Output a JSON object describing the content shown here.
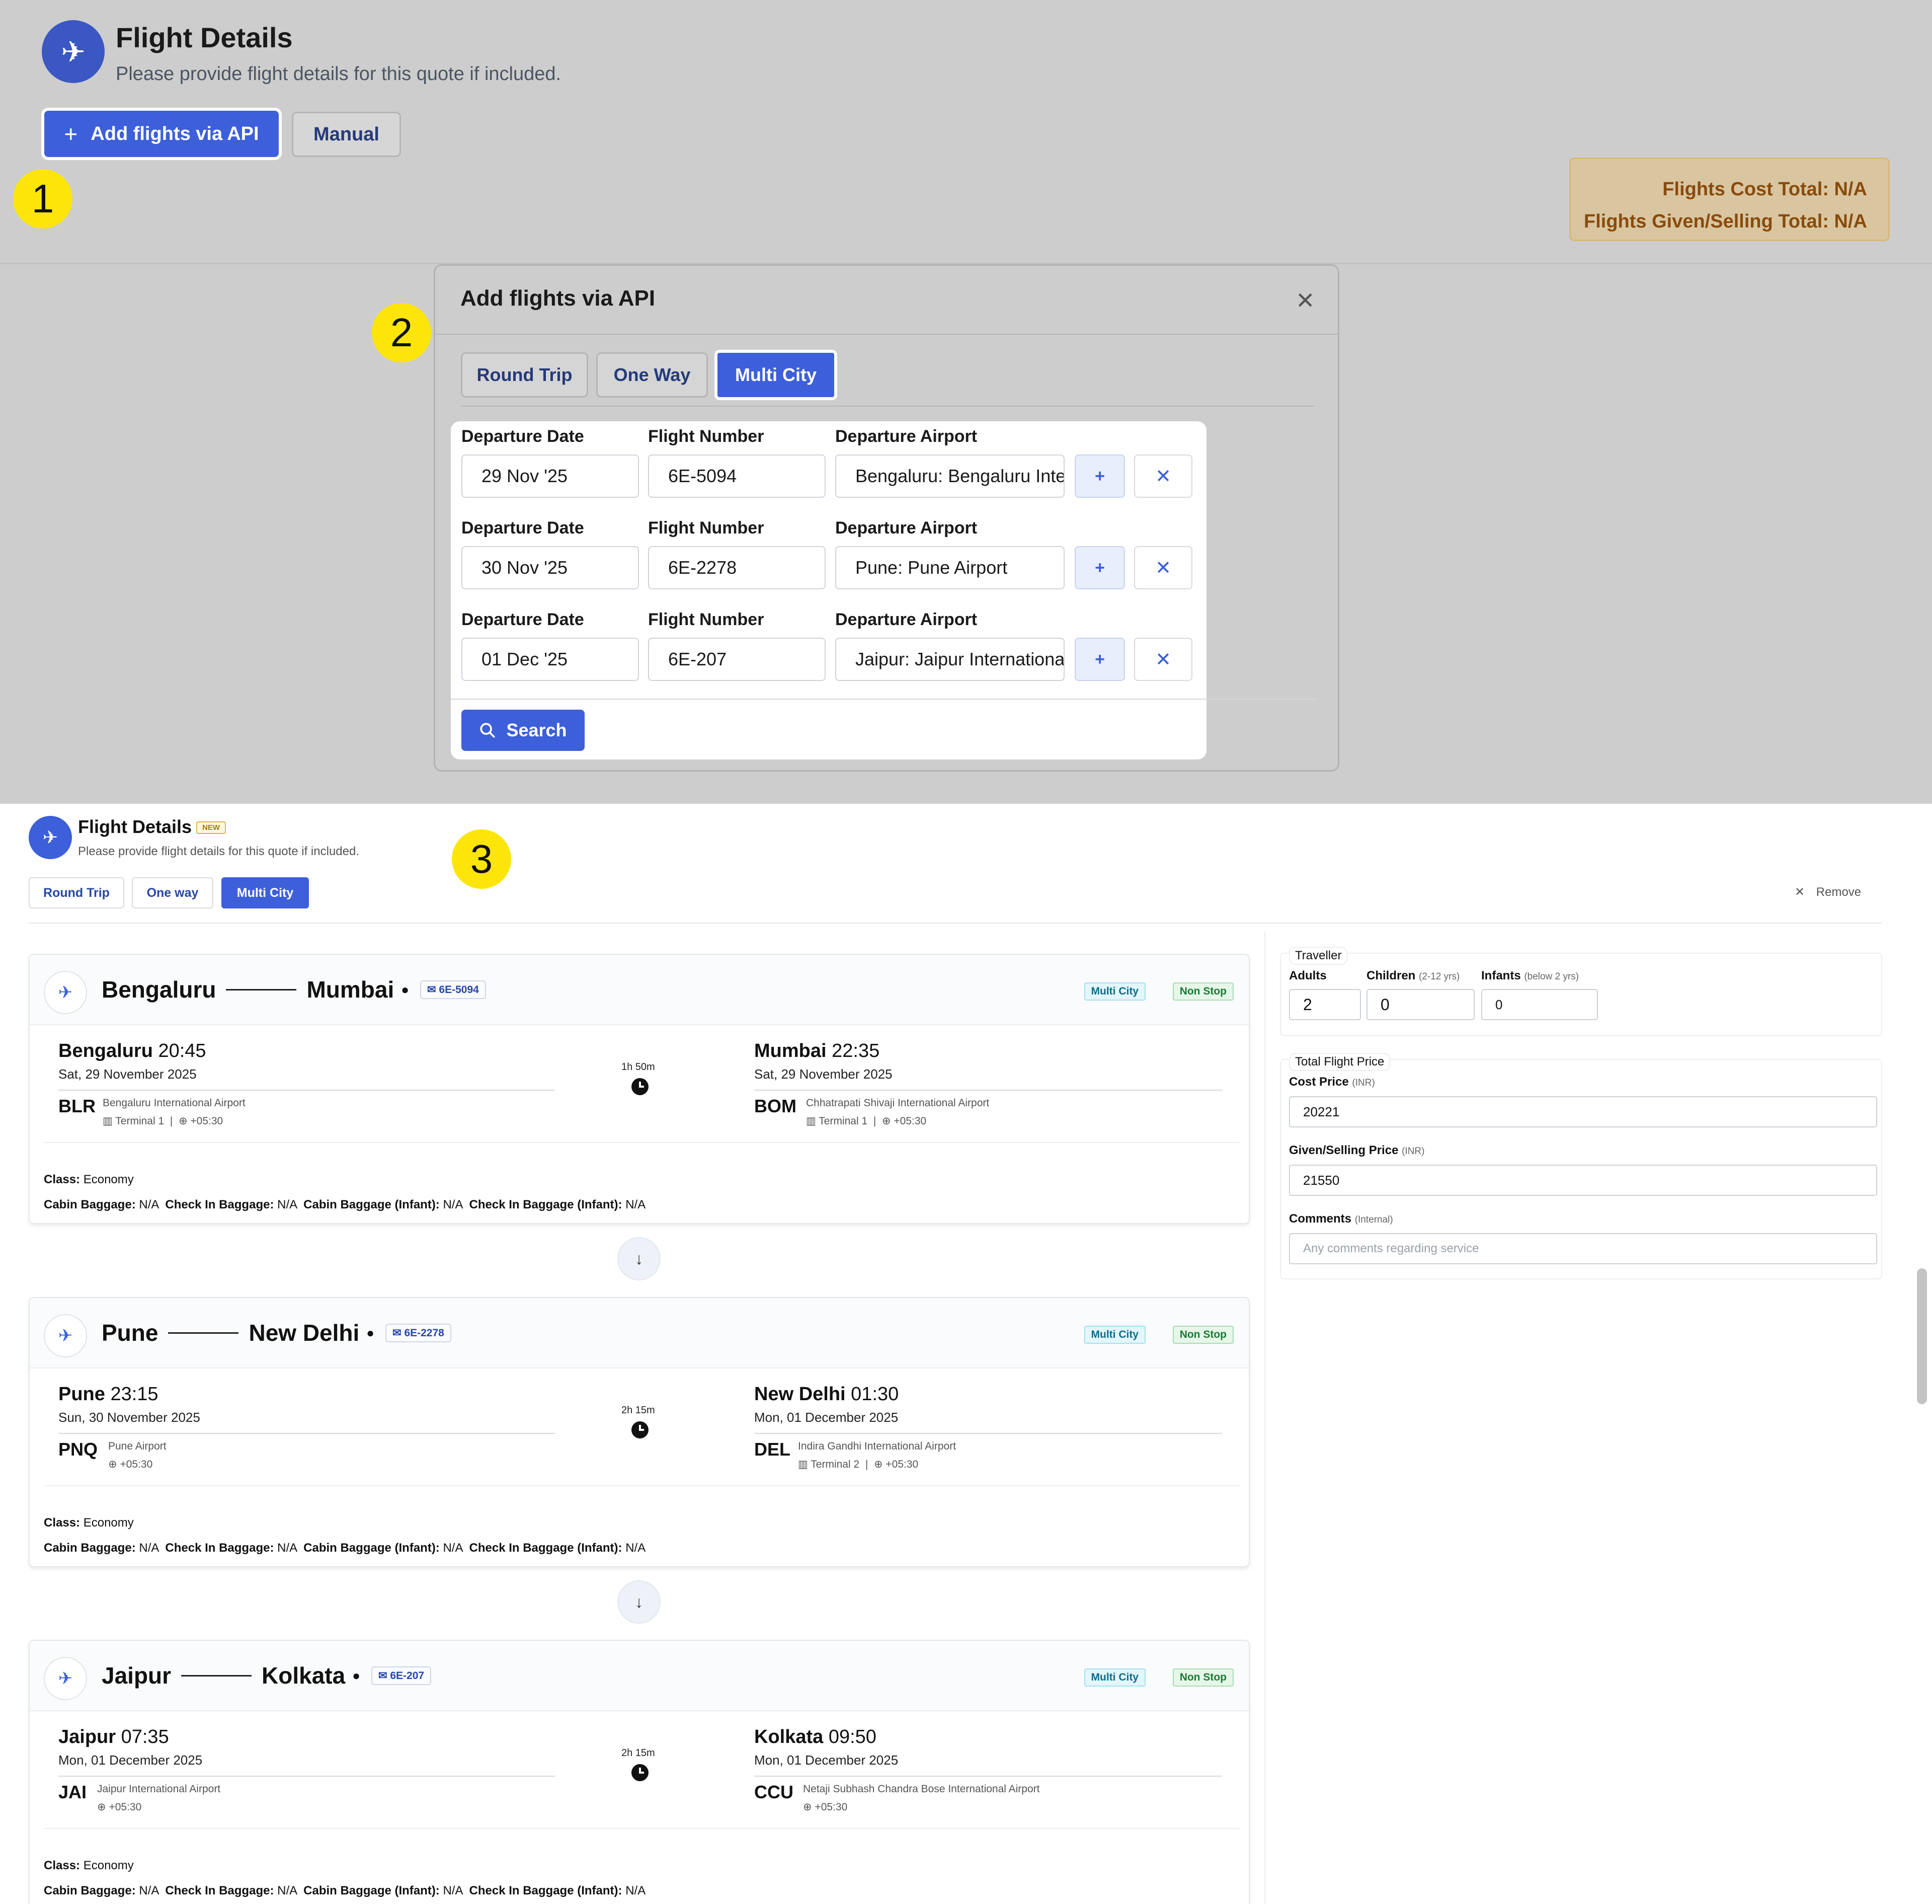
{
  "top": {
    "title": "Flight Details",
    "subtitle": "Please provide flight details for this quote if included.",
    "add_api_label": "Add flights via API",
    "manual_label": "Manual",
    "cost_total": "Flights Cost Total: N/A",
    "selling_total": "Flights Given/Selling Total: N/A"
  },
  "steps": [
    "1",
    "2",
    "3"
  ],
  "modal": {
    "title": "Add flights via API",
    "tabs": [
      "Round Trip",
      "One Way",
      "Multi City"
    ],
    "labels": {
      "date": "Departure Date",
      "flight": "Flight Number",
      "airport": "Departure Airport"
    },
    "rows": [
      {
        "date": "29 Nov '25",
        "flight": "6E-5094",
        "airport": "Bengaluru:  Bengaluru International Airport"
      },
      {
        "date": "30 Nov '25",
        "flight": "6E-2278",
        "airport": "Pune:  Pune Airport"
      },
      {
        "date": "01 Dec '25",
        "flight": "6E-207",
        "airport": "Jaipur:  Jaipur International Airport"
      }
    ],
    "search_label": "Search"
  },
  "panel3": {
    "title": "Flight Details",
    "new_badge": "NEW",
    "subtitle": "Please provide flight details for this quote if included.",
    "tabs": [
      "Round Trip",
      "One way",
      "Multi City"
    ],
    "remove_label": "Remove"
  },
  "flights": [
    {
      "from": "Bengaluru",
      "to": "Mumbai",
      "number": "6E-5094",
      "dep_time": "20:45",
      "dep_date": "Sat, 29 November 2025",
      "dep_code": "BLR",
      "dep_airport": "Bengaluru International Airport",
      "dep_terminal": "Terminal 1",
      "dep_tz": "+05:30",
      "duration": "1h 50m",
      "arr_time": "22:35",
      "arr_date": "Sat, 29 November 2025",
      "arr_code": "BOM",
      "arr_airport": "Chhatrapati Shivaji International Airport",
      "arr_terminal": "Terminal 1",
      "arr_tz": "+05:30"
    },
    {
      "from": "Pune",
      "to": "New Delhi",
      "number": "6E-2278",
      "dep_time": "23:15",
      "dep_date": "Sun, 30 November 2025",
      "dep_code": "PNQ",
      "dep_airport": "Pune Airport",
      "dep_terminal": "",
      "dep_tz": "+05:30",
      "duration": "2h 15m",
      "arr_time": "01:30",
      "arr_date": "Mon, 01 December 2025",
      "arr_code": "DEL",
      "arr_airport": "Indira Gandhi International Airport",
      "arr_terminal": "Terminal 2",
      "arr_tz": "+05:30"
    },
    {
      "from": "Jaipur",
      "to": "Kolkata",
      "number": "6E-207",
      "dep_time": "07:35",
      "dep_date": "Mon, 01 December 2025",
      "dep_code": "JAI",
      "dep_airport": "Jaipur International Airport",
      "dep_terminal": "",
      "dep_tz": "+05:30",
      "duration": "2h 15m",
      "arr_time": "09:50",
      "arr_date": "Mon, 01 December 2025",
      "arr_code": "CCU",
      "arr_airport": "Netaji Subhash Chandra Bose International Airport",
      "arr_terminal": "",
      "arr_tz": "+05:30"
    }
  ],
  "badges": {
    "multi_city": "Multi City",
    "non_stop": "Non Stop"
  },
  "info": {
    "class_label": "Class:",
    "class_value": "Economy",
    "cabin_label": "Cabin Baggage:",
    "checkin_label": "Check In Baggage:",
    "cabin_infant_label": "Cabin Baggage (Infant):",
    "checkin_infant_label": "Check In Baggage (Infant):",
    "na": "N/A"
  },
  "traveller": {
    "legend": "Traveller",
    "adults_label": "Adults",
    "children_label": "Children",
    "children_note": "(2-12 yrs)",
    "infants_label": "Infants",
    "infants_note": "(below 2 yrs)",
    "adults": "2",
    "children": "0",
    "infants": "0"
  },
  "price": {
    "legend": "Total Flight Price",
    "cost_label": "Cost Price",
    "cost_note": "(INR)",
    "cost": "20221",
    "selling_label": "Given/Selling Price",
    "selling_note": "(INR)",
    "selling": "21550",
    "comments_label": "Comments",
    "comments_note": "(Internal)",
    "comments_placeholder": "Any comments regarding service"
  },
  "colors": {
    "accent": "#3d5fd9",
    "step": "#fde50a",
    "totals_text": "#8a4b0c"
  }
}
